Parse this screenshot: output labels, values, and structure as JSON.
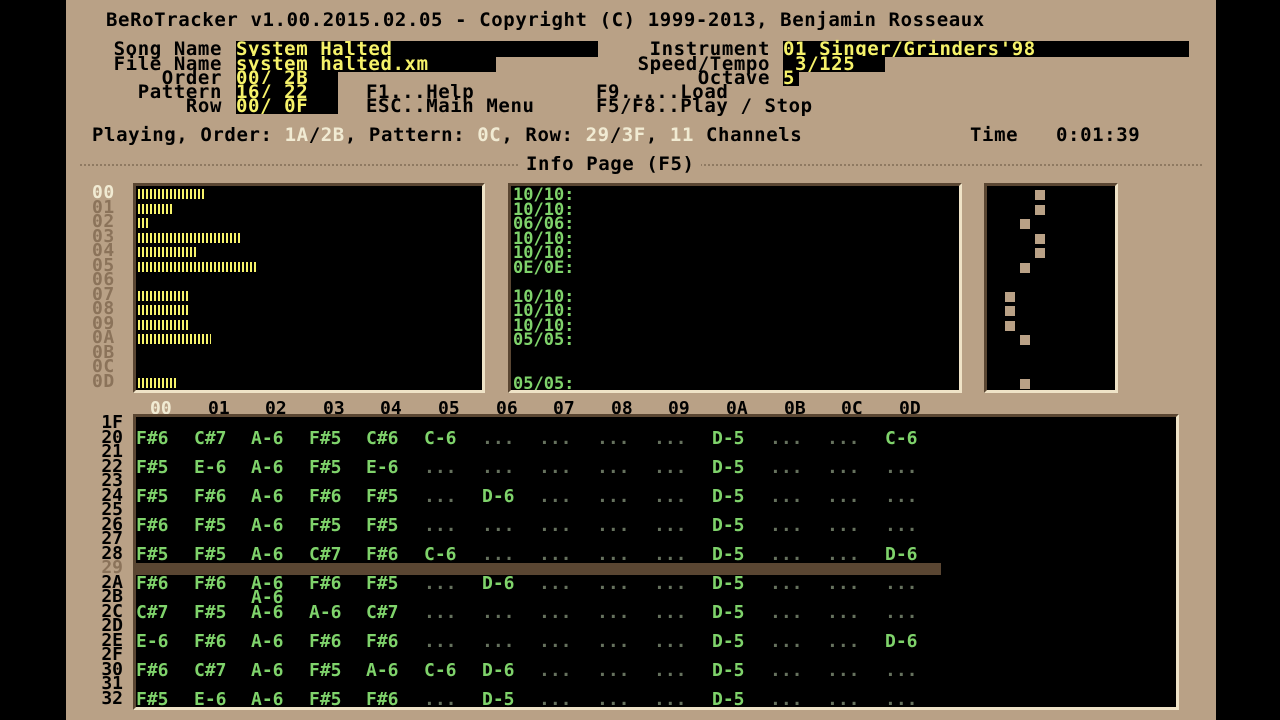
{
  "title": "BeRoTracker v1.00.2015.02.05 - Copyright (C) 1999-2013, Benjamin Rosseaux",
  "fields": {
    "song_name_label": "Song Name",
    "song_name": "System Halted",
    "file_name_label": "File Name",
    "file_name": "system_halted.xm",
    "order_label": "Order",
    "order": "00/ 2B",
    "pattern_label": "Pattern",
    "pattern": "16/ 22",
    "row_label": "Row",
    "row": "00/ 0F",
    "instrument_label": "Instrument",
    "instrument": "01 Singer/Grinders'98",
    "speed_tempo_label": "Speed/Tempo",
    "speed_tempo": " 3/125",
    "octave_label": "Octave",
    "octave": "5"
  },
  "keys": {
    "f1": "F1...Help",
    "esc": "ESC..Main Menu",
    "f9": "F9.....Load",
    "f5f8": "F5/F8..Play / Stop"
  },
  "status": {
    "playing_label": "Playing, Order: ",
    "order_pos": "1A",
    "slash1": "/",
    "order_total": "2B",
    "pattern_label": ", Pattern: ",
    "pattern": "0C",
    "row_label": ", Row: ",
    "row_pos": "29",
    "slash2": "/",
    "row_total": "3F",
    "sep": ", ",
    "channels_num": "11",
    "channels_label": " Channels",
    "time_label": "Time",
    "time": "0:01:39"
  },
  "info_title": "Info Page (F5)",
  "channels": [
    {
      "id": "00",
      "level": 0.2,
      "vol": "10/10:",
      "pan": 0.4
    },
    {
      "id": "01",
      "level": 0.11,
      "vol": "10/10:",
      "pan": 0.4
    },
    {
      "id": "02",
      "level": 0.03,
      "vol": "06/06:",
      "pan": 0.25
    },
    {
      "id": "03",
      "level": 0.31,
      "vol": "10/10:",
      "pan": 0.4
    },
    {
      "id": "04",
      "level": 0.18,
      "vol": "10/10:",
      "pan": 0.4
    },
    {
      "id": "05",
      "level": 0.36,
      "vol": "0E/0E:",
      "pan": 0.25
    },
    {
      "id": "06",
      "level": 0.0,
      "vol": "",
      "pan": null
    },
    {
      "id": "07",
      "level": 0.15,
      "vol": "10/10:",
      "pan": 0.1
    },
    {
      "id": "08",
      "level": 0.15,
      "vol": "10/10:",
      "pan": 0.1
    },
    {
      "id": "09",
      "level": 0.15,
      "vol": "10/10:",
      "pan": 0.1
    },
    {
      "id": "0A",
      "level": 0.22,
      "vol": "05/05:",
      "pan": 0.25
    },
    {
      "id": "0B",
      "level": 0.0,
      "vol": "",
      "pan": null
    },
    {
      "id": "0C",
      "level": 0.0,
      "vol": "",
      "pan": null
    },
    {
      "id": "0D",
      "level": 0.12,
      "vol": "05/05:",
      "pan": 0.25
    }
  ],
  "pattern": {
    "channel_headers": [
      "00",
      "01",
      "02",
      "03",
      "04",
      "05",
      "06",
      "07",
      "08",
      "09",
      "0A",
      "0B",
      "0C",
      "0D"
    ],
    "current_channel": "00",
    "current_row": "29",
    "rows": [
      {
        "num": "1F",
        "cells": [
          "",
          "",
          "",
          "",
          "",
          "",
          "",
          "",
          "",
          "",
          "",
          "",
          "",
          ""
        ]
      },
      {
        "num": "20",
        "cells": [
          "F#6",
          "C#7",
          "A-6",
          "F#5",
          "C#6",
          "C-6",
          "...",
          "...",
          "...",
          "...",
          "D-5",
          "...",
          "...",
          "C-6"
        ]
      },
      {
        "num": "21",
        "cells": [
          "",
          "",
          "",
          "",
          "",
          "",
          "",
          "",
          "",
          "",
          "",
          "",
          "",
          ""
        ]
      },
      {
        "num": "22",
        "cells": [
          "F#5",
          "E-6",
          "A-6",
          "F#5",
          "E-6",
          "...",
          "...",
          "...",
          "...",
          "...",
          "D-5",
          "...",
          "...",
          "..."
        ]
      },
      {
        "num": "23",
        "cells": [
          "",
          "",
          "",
          "",
          "",
          "",
          "",
          "",
          "",
          "",
          "",
          "",
          "",
          ""
        ]
      },
      {
        "num": "24",
        "cells": [
          "F#5",
          "F#6",
          "A-6",
          "F#6",
          "F#5",
          "...",
          "D-6",
          "...",
          "...",
          "...",
          "D-5",
          "...",
          "...",
          "..."
        ]
      },
      {
        "num": "25",
        "cells": [
          "",
          "",
          "",
          "",
          "",
          "",
          "",
          "",
          "",
          "",
          "",
          "",
          "",
          ""
        ]
      },
      {
        "num": "26",
        "cells": [
          "F#6",
          "F#5",
          "A-6",
          "F#5",
          "F#5",
          "...",
          "...",
          "...",
          "...",
          "...",
          "D-5",
          "...",
          "...",
          "..."
        ]
      },
      {
        "num": "27",
        "cells": [
          "",
          "",
          "",
          "",
          "",
          "",
          "",
          "",
          "",
          "",
          "",
          "",
          "",
          ""
        ]
      },
      {
        "num": "28",
        "cells": [
          "F#5",
          "F#5",
          "A-6",
          "C#7",
          "F#6",
          "C-6",
          "...",
          "...",
          "...",
          "...",
          "D-5",
          "...",
          "...",
          "D-6"
        ]
      },
      {
        "num": "29",
        "cells": [
          "",
          "",
          "",
          "",
          "",
          "",
          "",
          "",
          "",
          "",
          "",
          "",
          "",
          ""
        ]
      },
      {
        "num": "2A",
        "cells": [
          "F#6",
          "F#6",
          "A-6",
          "F#6",
          "F#5",
          "...",
          "D-6",
          "...",
          "...",
          "...",
          "D-5",
          "...",
          "...",
          "..."
        ]
      },
      {
        "num": "2B",
        "cells": [
          "",
          "",
          "A-6",
          "",
          "",
          "",
          "",
          "",
          "",
          "",
          "",
          "",
          "",
          ""
        ]
      },
      {
        "num": "2C",
        "cells": [
          "C#7",
          "F#5",
          "A-6",
          "A-6",
          "C#7",
          "...",
          "...",
          "...",
          "...",
          "...",
          "D-5",
          "...",
          "...",
          "..."
        ]
      },
      {
        "num": "2D",
        "cells": [
          "",
          "",
          "",
          "",
          "",
          "",
          "",
          "",
          "",
          "",
          "",
          "",
          "",
          ""
        ]
      },
      {
        "num": "2E",
        "cells": [
          "E-6",
          "F#6",
          "A-6",
          "F#6",
          "F#6",
          "...",
          "...",
          "...",
          "...",
          "...",
          "D-5",
          "...",
          "...",
          "D-6"
        ]
      },
      {
        "num": "2F",
        "cells": [
          "",
          "",
          "",
          "",
          "",
          "",
          "",
          "",
          "",
          "",
          "",
          "",
          "",
          ""
        ]
      },
      {
        "num": "30",
        "cells": [
          "F#6",
          "C#7",
          "A-6",
          "F#5",
          "A-6",
          "C-6",
          "D-6",
          "...",
          "...",
          "...",
          "D-5",
          "...",
          "...",
          "..."
        ]
      },
      {
        "num": "31",
        "cells": [
          "",
          "",
          "",
          "",
          "",
          "",
          "",
          "",
          "",
          "",
          "",
          "",
          "",
          ""
        ]
      },
      {
        "num": "32",
        "cells": [
          "F#5",
          "E-6",
          "A-6",
          "F#5",
          "F#6",
          "...",
          "D-5",
          "...",
          "...",
          "...",
          "D-5",
          "...",
          "...",
          "..."
        ]
      }
    ]
  },
  "colors": {
    "frame": "#b9a186",
    "field_text": "#f6f26a",
    "note_text": "#7fd36b",
    "highlight_text": "#f1ebd3"
  }
}
